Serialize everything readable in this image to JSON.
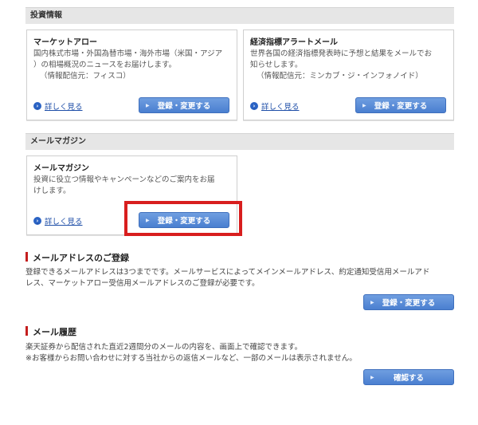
{
  "investment_info": {
    "section_title": "投資情報",
    "market_arrow": {
      "title": "マーケットアロー",
      "desc_line1": "国内株式市場・外国為替市場・海外市場（米国・アジア",
      "desc_line2": "）の相場概況のニュースをお届けします。",
      "source": "（情報配信元：フィスコ）",
      "detail_link": "詳しく見る",
      "button": "登録・変更する"
    },
    "economic_alert": {
      "title": "経済指標アラートメール",
      "desc_line1": "世界各国の経済指標発表時に予想と結果をメールでお",
      "desc_line2": "知らせします。",
      "source": "（情報配信元：ミンカブ・ジ・インフォノイド）",
      "detail_link": "詳しく見る",
      "button": "登録・変更する"
    }
  },
  "mail_magazine": {
    "section_title": "メールマガジン",
    "card": {
      "title": "メールマガジン",
      "desc_line1": "投資に役立つ情報やキャンペーンなどのご案内をお届",
      "desc_line2": "けします。",
      "detail_link": "詳しく見る",
      "button": "登録・変更する"
    }
  },
  "mail_address": {
    "heading": "メールアドレスのご登録",
    "text_line1": "登録できるメールアドレスは3つまでです。メールサービスによってメインメールアドレス、約定通知受信用メールアド",
    "text_line2": "レス、マーケットアロー受信用メールアドレスのご登録が必要です。",
    "button": "登録・変更する"
  },
  "mail_history": {
    "heading": "メール履歴",
    "text_line1": "楽天証券から配信された直近2週間分のメールの内容を、画面上で確認できます。",
    "text_line2": "※お客様からお問い合わせに対する当社からの返信メールなど、一部のメールは表示されません。",
    "button": "確認する"
  },
  "icons": {
    "detail": "circle-arrow-icon",
    "button_arrow": "triangle-right-icon"
  },
  "colors": {
    "button": "#5a8cd8",
    "link": "#1f4fa8",
    "highlight": "#d81e1e",
    "accent_bar": "#c41e1e",
    "section_bar": "#e6e6e6"
  }
}
